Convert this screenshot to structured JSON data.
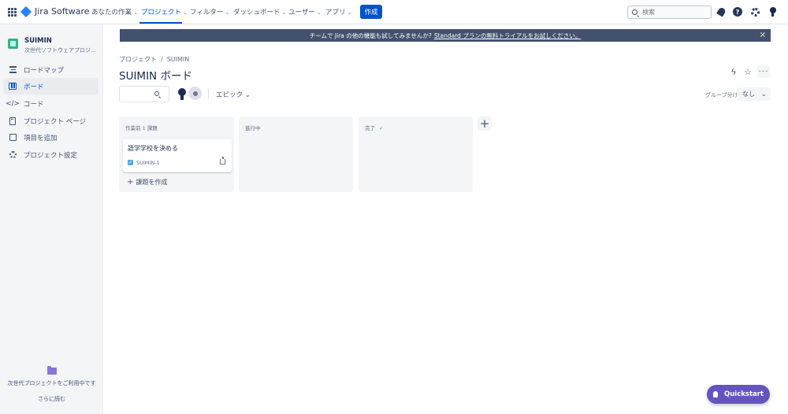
{
  "topnav": {
    "product": "Jira Software",
    "items": [
      {
        "label": "あなたの作業"
      },
      {
        "label": "プロジェクト"
      },
      {
        "label": "フィルター"
      },
      {
        "label": "ダッシュボード"
      },
      {
        "label": "ユーザー"
      },
      {
        "label": "アプリ"
      }
    ],
    "create_label": "作成",
    "search_placeholder": "検索",
    "icons": [
      "app-switcher-icon",
      "notifications-icon",
      "help-icon",
      "settings-icon",
      "profile-avatar"
    ]
  },
  "sidebar": {
    "project_name": "SUIMIN",
    "project_type": "次世代ソフトウェアプロジ...",
    "items": [
      {
        "label": "ロードマップ",
        "icon": "roadmap-icon"
      },
      {
        "label": "ボード",
        "icon": "board-icon"
      },
      {
        "label": "コード",
        "icon": "code-icon"
      },
      {
        "label": "プロジェクト ページ",
        "icon": "page-icon"
      },
      {
        "label": "項目を追加",
        "icon": "add-item-icon"
      },
      {
        "label": "プロジェクト設定",
        "icon": "gear-icon"
      }
    ],
    "footer_text": "次世代プロジェクトをご利用中です",
    "footer_link": "さらに読む"
  },
  "banner": {
    "text": "チームで Jira の他の機能も試してみませんか?",
    "link": "Standard プランの無料トライアルをお試しください。",
    "close": "×"
  },
  "breadcrumb": {
    "root": "プロジェクト",
    "sep": "/",
    "current": "SUIMIN"
  },
  "page_title": "SUIMIN ボード",
  "toolbar": {
    "epic_label": "エピック",
    "group_label": "グループ分け",
    "group_value": "なし"
  },
  "columns": [
    {
      "title": "作業前 1 課題",
      "cards": [
        {
          "title": "語学学校を決める",
          "key": "SUIMIN-1"
        }
      ],
      "create_label": "課題を作成"
    },
    {
      "title": "進行中",
      "cards": []
    },
    {
      "title": "完了",
      "done_mark": "✓",
      "cards": []
    }
  ],
  "quickstart_label": "Quickstart",
  "colors": {
    "accent": "#0052cc",
    "banner": "#42526e",
    "quickstart": "#6554c0",
    "sidebar_bg": "#f4f5f7"
  }
}
